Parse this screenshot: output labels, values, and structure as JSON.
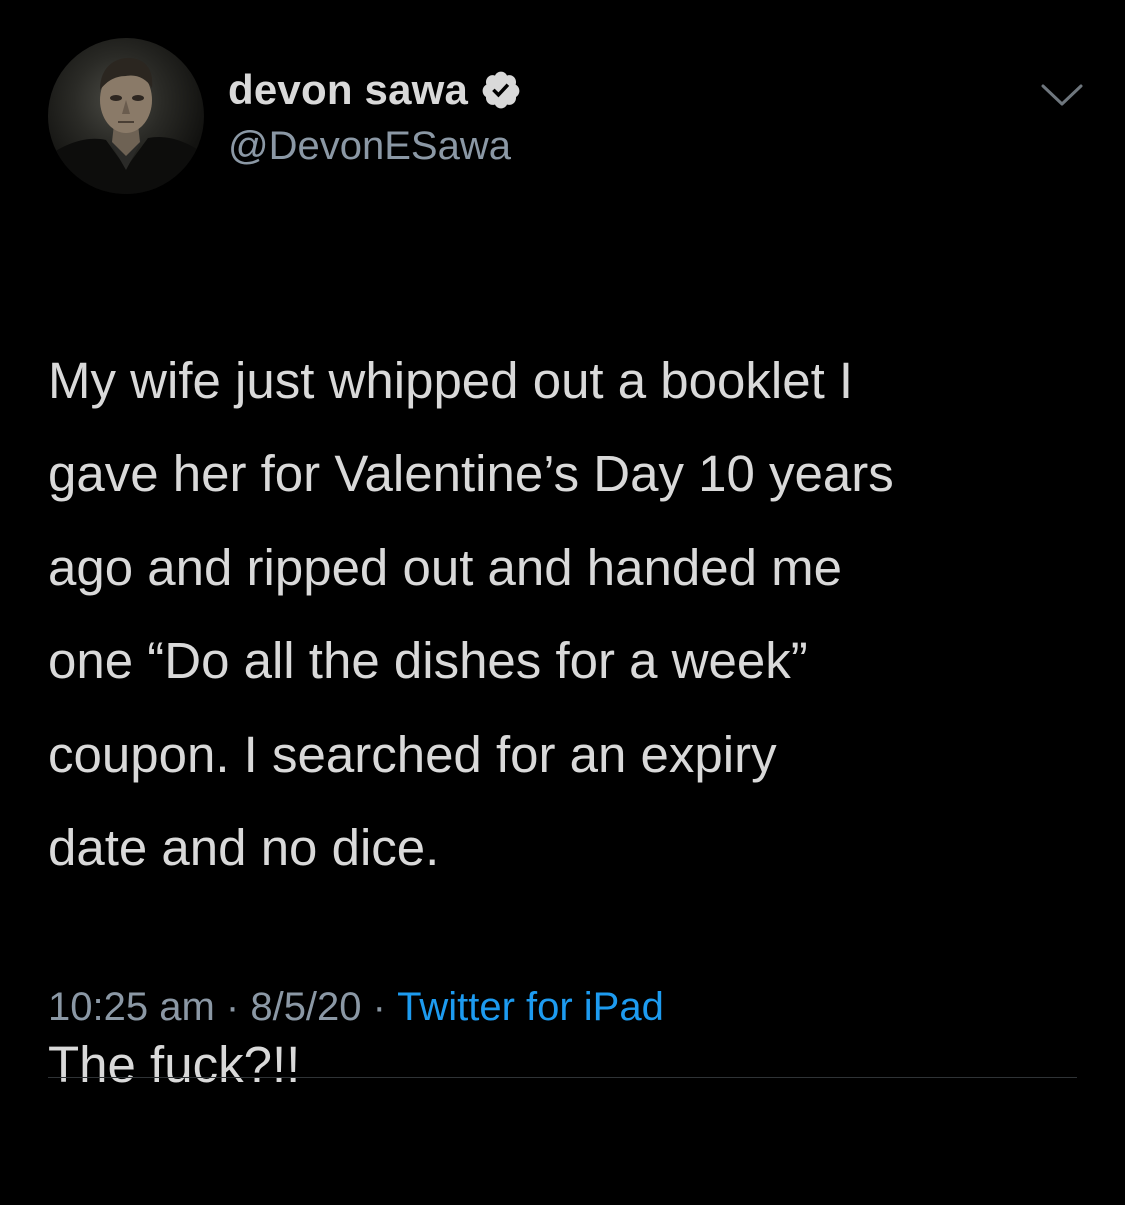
{
  "author": {
    "display_name": "devon sawa",
    "handle": "@DevonESawa",
    "verified": true,
    "avatar_icon": "profile-photo"
  },
  "tweet": {
    "text": "My wife just whipped out a booklet I\ngave her for Valentine’s Day 10 years\nago and ripped out and handed me\none “Do all the dishes for a week”\ncoupon.  I searched for an expiry\ndate and no dice.",
    "text_2": "The fuck?!!"
  },
  "meta": {
    "time": "10:25 am",
    "separator": " · ",
    "date": "8/5/20",
    "source": "Twitter for iPad"
  },
  "icons": {
    "verified": "verified-badge-icon",
    "menu": "chevron-down-icon"
  },
  "colors": {
    "background": "#000000",
    "text": "#d9d9d9",
    "secondary": "#8b98a5",
    "link": "#1d9bf0"
  }
}
